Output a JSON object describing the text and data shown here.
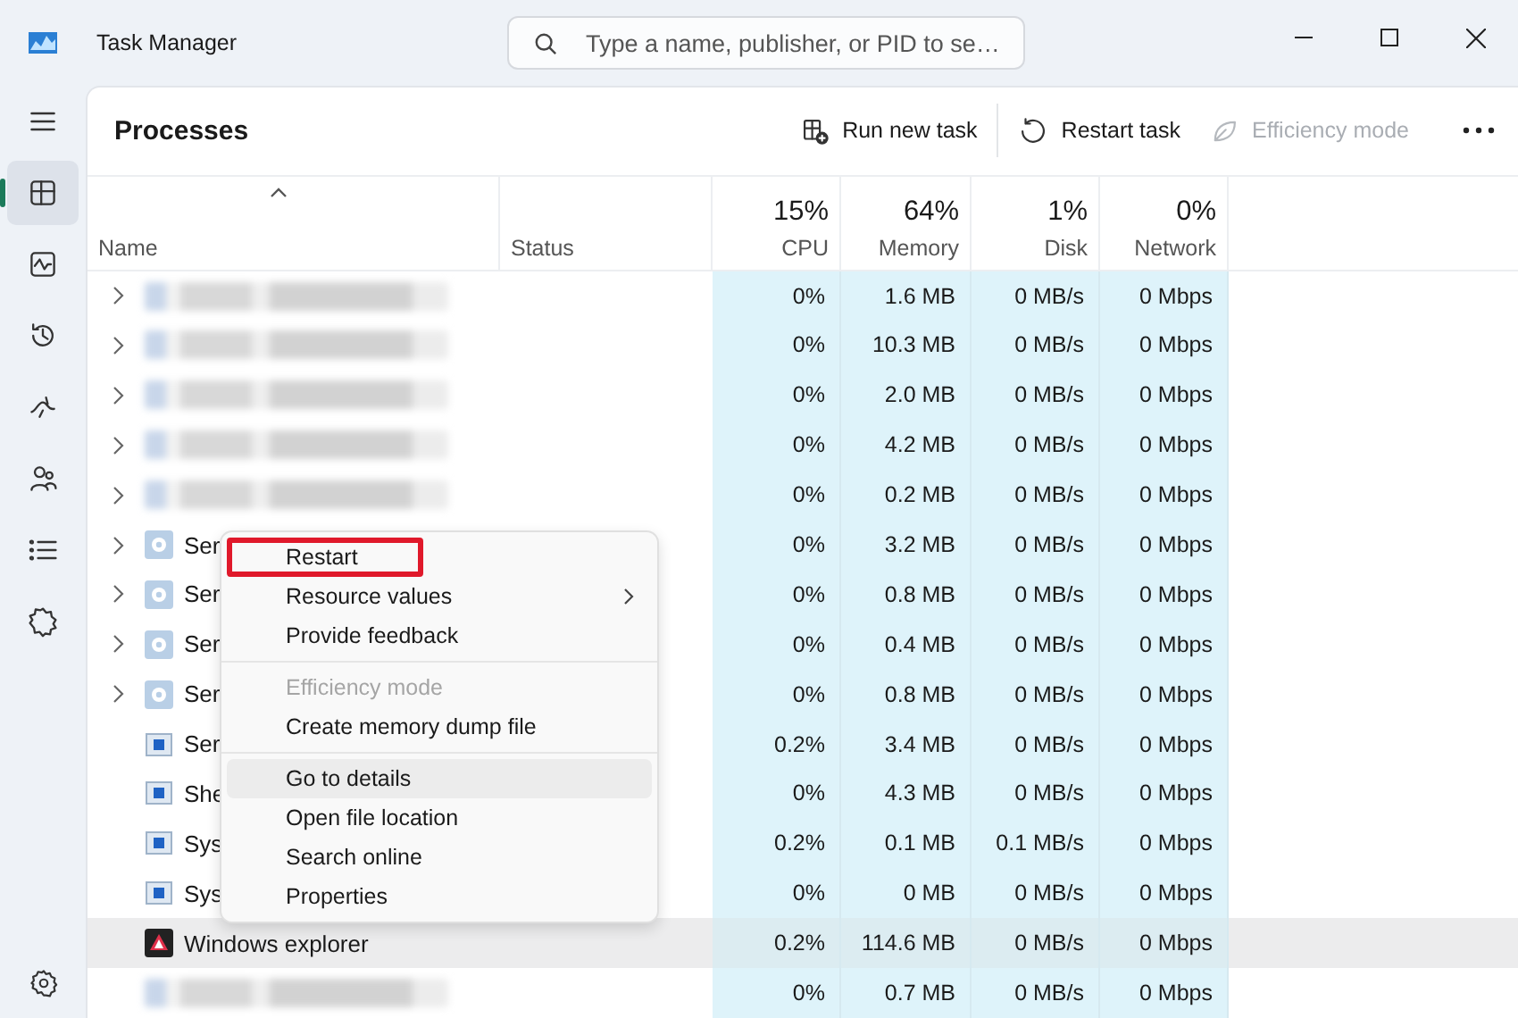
{
  "window": {
    "title": "Task Manager"
  },
  "search": {
    "placeholder": "Type a name, publisher, or PID to se…"
  },
  "sidebar": {
    "items": [
      {
        "selected": false
      },
      {
        "selected": true
      },
      {
        "selected": false
      },
      {
        "selected": false
      },
      {
        "selected": false
      },
      {
        "selected": false
      },
      {
        "selected": false
      },
      {
        "selected": false
      }
    ],
    "footer": {
      "selected": false
    }
  },
  "page_title": "Processes",
  "toolbar": [
    {
      "label": "Run new task",
      "disabled": false
    },
    {
      "label": "Restart task",
      "disabled": false
    },
    {
      "label": "Efficiency mode",
      "disabled": true
    }
  ],
  "table": {
    "columns": [
      {
        "label": "Name",
        "sorted": true
      },
      {
        "label": "Status",
        "sorted": false
      },
      {
        "label": "CPU",
        "total": "15%",
        "sorted": false
      },
      {
        "label": "Memory",
        "total": "64%",
        "sorted": false
      },
      {
        "label": "Disk",
        "total": "1%",
        "sorted": false
      },
      {
        "label": "Network",
        "total": "0%",
        "sorted": false
      }
    ],
    "rows": [
      {
        "kind": "blurred",
        "expandable": true,
        "selected": false,
        "cpu": "0%",
        "memory": "1.6 MB",
        "disk": "0 MB/s",
        "network": "0 Mbps"
      },
      {
        "kind": "blurred",
        "expandable": true,
        "selected": false,
        "cpu": "0%",
        "memory": "10.3 MB",
        "disk": "0 MB/s",
        "network": "0 Mbps"
      },
      {
        "kind": "blurred",
        "expandable": true,
        "selected": false,
        "cpu": "0%",
        "memory": "2.0 MB",
        "disk": "0 MB/s",
        "network": "0 Mbps"
      },
      {
        "kind": "blurred",
        "expandable": true,
        "selected": false,
        "cpu": "0%",
        "memory": "4.2 MB",
        "disk": "0 MB/s",
        "network": "0 Mbps"
      },
      {
        "kind": "blurred",
        "expandable": true,
        "selected": false,
        "cpu": "0%",
        "memory": "0.2 MB",
        "disk": "0 MB/s",
        "network": "0 Mbps"
      },
      {
        "kind": "service",
        "name": "Ser",
        "expandable": true,
        "selected": false,
        "cpu": "0%",
        "memory": "3.2 MB",
        "disk": "0 MB/s",
        "network": "0 Mbps"
      },
      {
        "kind": "service",
        "name": "Ser",
        "expandable": true,
        "selected": false,
        "cpu": "0%",
        "memory": "0.8 MB",
        "disk": "0 MB/s",
        "network": "0 Mbps"
      },
      {
        "kind": "service",
        "name": "Ser",
        "expandable": true,
        "selected": false,
        "cpu": "0%",
        "memory": "0.4 MB",
        "disk": "0 MB/s",
        "network": "0 Mbps"
      },
      {
        "kind": "service",
        "name": "Ser",
        "expandable": true,
        "selected": false,
        "cpu": "0%",
        "memory": "0.8 MB",
        "disk": "0 MB/s",
        "network": "0 Mbps"
      },
      {
        "kind": "window",
        "name": "Ser",
        "expandable": false,
        "selected": false,
        "cpu": "0.2%",
        "memory": "3.4 MB",
        "disk": "0 MB/s",
        "network": "0 Mbps"
      },
      {
        "kind": "window",
        "name": "She",
        "expandable": false,
        "selected": false,
        "cpu": "0%",
        "memory": "4.3 MB",
        "disk": "0 MB/s",
        "network": "0 Mbps"
      },
      {
        "kind": "window",
        "name": "Sys",
        "expandable": false,
        "selected": false,
        "cpu": "0.2%",
        "memory": "0.1 MB",
        "disk": "0.1 MB/s",
        "network": "0 Mbps"
      },
      {
        "kind": "window",
        "name": "Sys",
        "expandable": false,
        "selected": false,
        "cpu": "0%",
        "memory": "0 MB",
        "disk": "0 MB/s",
        "network": "0 Mbps"
      },
      {
        "kind": "explorer",
        "name": "Windows explorer",
        "expandable": false,
        "selected": true,
        "cpu": "0.2%",
        "memory": "114.6 MB",
        "disk": "0 MB/s",
        "network": "0 Mbps"
      },
      {
        "kind": "blurred",
        "expandable": false,
        "selected": false,
        "cpu": "0%",
        "memory": "0.7 MB",
        "disk": "0 MB/s",
        "network": "0 Mbps"
      }
    ]
  },
  "context_menu": {
    "groups": [
      [
        {
          "label": "Restart",
          "disabled": false,
          "selected": false,
          "outlined": true,
          "submenu": false
        },
        {
          "label": "Resource values",
          "disabled": false,
          "selected": false,
          "outlined": false,
          "submenu": true
        },
        {
          "label": "Provide feedback",
          "disabled": false,
          "selected": false,
          "outlined": false,
          "submenu": false
        }
      ],
      [
        {
          "label": "Efficiency mode",
          "disabled": true,
          "selected": false,
          "outlined": false,
          "submenu": false
        },
        {
          "label": "Create memory dump file",
          "disabled": false,
          "selected": false,
          "outlined": false,
          "submenu": false
        }
      ],
      [
        {
          "label": "Go to details",
          "disabled": false,
          "selected": true,
          "outlined": false,
          "submenu": false
        },
        {
          "label": "Open file location",
          "disabled": false,
          "selected": false,
          "outlined": false,
          "submenu": false
        },
        {
          "label": "Search online",
          "disabled": false,
          "selected": false,
          "outlined": false,
          "submenu": false
        },
        {
          "label": "Properties",
          "disabled": false,
          "selected": false,
          "outlined": false,
          "submenu": false
        }
      ]
    ]
  }
}
